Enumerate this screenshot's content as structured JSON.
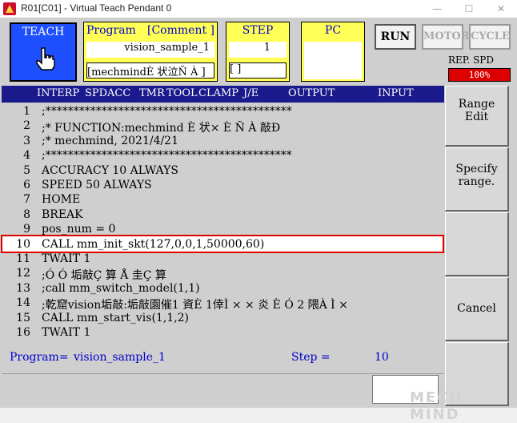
{
  "window": {
    "title": "R01[C01] - Virtual Teach Pendant 0",
    "minimize": "—",
    "maximize": "☐",
    "close": "✕"
  },
  "mode": {
    "label": "TEACH",
    "icon": "hand-pointer-icon"
  },
  "program_box": {
    "label": "Program",
    "comment_label": "[Comment ]",
    "name": "vision_sample_1",
    "comment": "[mechmindÈ 状泣Ñ À ]"
  },
  "step_box": {
    "label": "STEP",
    "value": "1",
    "sub": "[       ]"
  },
  "pc_box": {
    "label": "PC"
  },
  "buttons": {
    "run": "RUN",
    "motor": "MOTOR",
    "cycle": "CYCLE"
  },
  "speed": {
    "label": "REP. SPD",
    "value": "100%",
    "level_percent": 100
  },
  "columns": [
    "INTERP",
    "SPD",
    "ACC",
    "TMR",
    "TOOL",
    "CLAMP",
    "J/E",
    "OUTPUT",
    "INPUT"
  ],
  "code": [
    {
      "n": "1",
      "text": ";********************************************"
    },
    {
      "n": "2",
      "text": ";* FUNCTION:mechmind È 状× È Ñ À 敲Ð"
    },
    {
      "n": "3",
      "text": ";* mechmind, 2021/4/21"
    },
    {
      "n": "4",
      "text": ";********************************************"
    },
    {
      "n": "5",
      "text": "ACCURACY 10 ALWAYS"
    },
    {
      "n": "6",
      "text": "SPEED 50 ALWAYS"
    },
    {
      "n": "7",
      "text": "HOME"
    },
    {
      "n": "8",
      "text": "BREAK"
    },
    {
      "n": "9",
      "text": "pos_num = 0"
    },
    {
      "n": "10",
      "text": "CALL mm_init_skt(127,0,0,1,50000,60)"
    },
    {
      "n": "11",
      "text": "TWAIT 1"
    },
    {
      "n": "12",
      "text": ";Ó Ó 垢敲Ç 算  Å 圭Ç 算"
    },
    {
      "n": "13",
      "text": ";call mm_switch_model(1,1)"
    },
    {
      "n": "14",
      "text": ";乾窟vision垢敲:垢敲園催1  資È 1倖Ì × × 炎  È Ó 2  隈À Ì ×"
    },
    {
      "n": "15",
      "text": "CALL mm_start_vis(1,1,2)"
    },
    {
      "n": "16",
      "text": "TWAIT 1"
    }
  ],
  "side": {
    "range_edit": [
      "Range",
      "Edit"
    ],
    "specify_range": [
      "Specify",
      "range."
    ],
    "cancel": "Cancel"
  },
  "status": {
    "program_label": "Program=",
    "program_value": "vision_sample_1",
    "step_label": "Step =",
    "step_value": "10"
  },
  "watermark": "MECH MIND"
}
